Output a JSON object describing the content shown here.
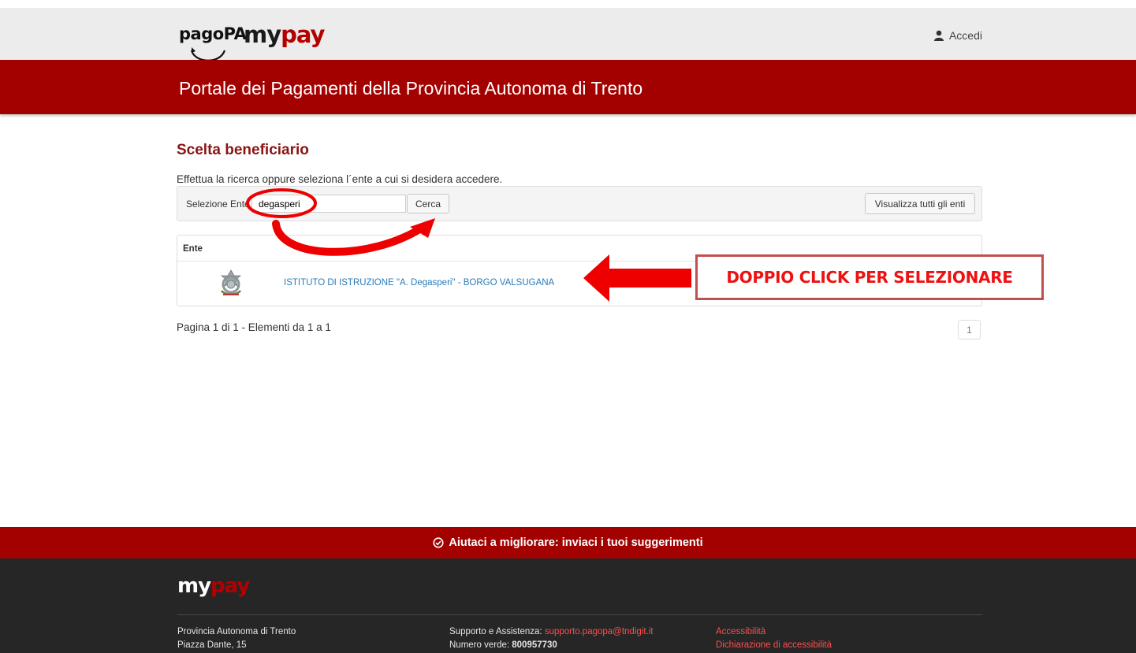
{
  "header": {
    "logo_pagopa": "pagoPA",
    "logo_my": "my",
    "logo_pay": "pay",
    "login_label": "Accedi",
    "user_icon": "user-icon"
  },
  "banner": {
    "title": "Portale dei Pagamenti della Provincia Autonoma di Trento"
  },
  "main": {
    "heading": "Scelta beneficiario",
    "intro": "Effettua la ricerca oppure seleziona l´ente a cui si desidera accedere.",
    "search": {
      "label": "Selezione Ente",
      "value": "degasperi",
      "button": "Cerca",
      "show_all_button": "Visualizza tutti gli enti"
    },
    "table": {
      "header": "Ente",
      "rows": [
        {
          "emblem": "italian-republic-emblem-icon",
          "name": "ISTITUTO DI ISTRUZIONE \"A. Degasperi\" - BORGO VALSUGANA"
        }
      ]
    },
    "pagination": {
      "info": "Pagina 1 di 1 - Elementi da 1 a 1",
      "current": "1"
    }
  },
  "annotation": {
    "callout_text": "DOPPIO CLICK PER SELEZIONARE",
    "arrow_color": "#ff0000"
  },
  "footer": {
    "feedback": "Aiutaci a migliorare: inviaci i tuoi suggerimenti",
    "logo_my": "my",
    "logo_pay": "pay",
    "address_line1": "Provincia Autonoma di Trento",
    "address_line2": "Piazza Dante, 15",
    "support_label": "Supporto e Assistenza:",
    "support_email": "supporto.pagopa@tndigit.it",
    "phone_label": "Numero verde:",
    "phone_number": "800957730",
    "accessibility": "Accessibilità",
    "accessibility_statement": "Dichiarazione di accessibilità"
  },
  "colors": {
    "brand_red": "#a30000",
    "heading_red": "#8b1414",
    "link_blue": "#2a7ab8",
    "footer_dark": "#262626"
  }
}
